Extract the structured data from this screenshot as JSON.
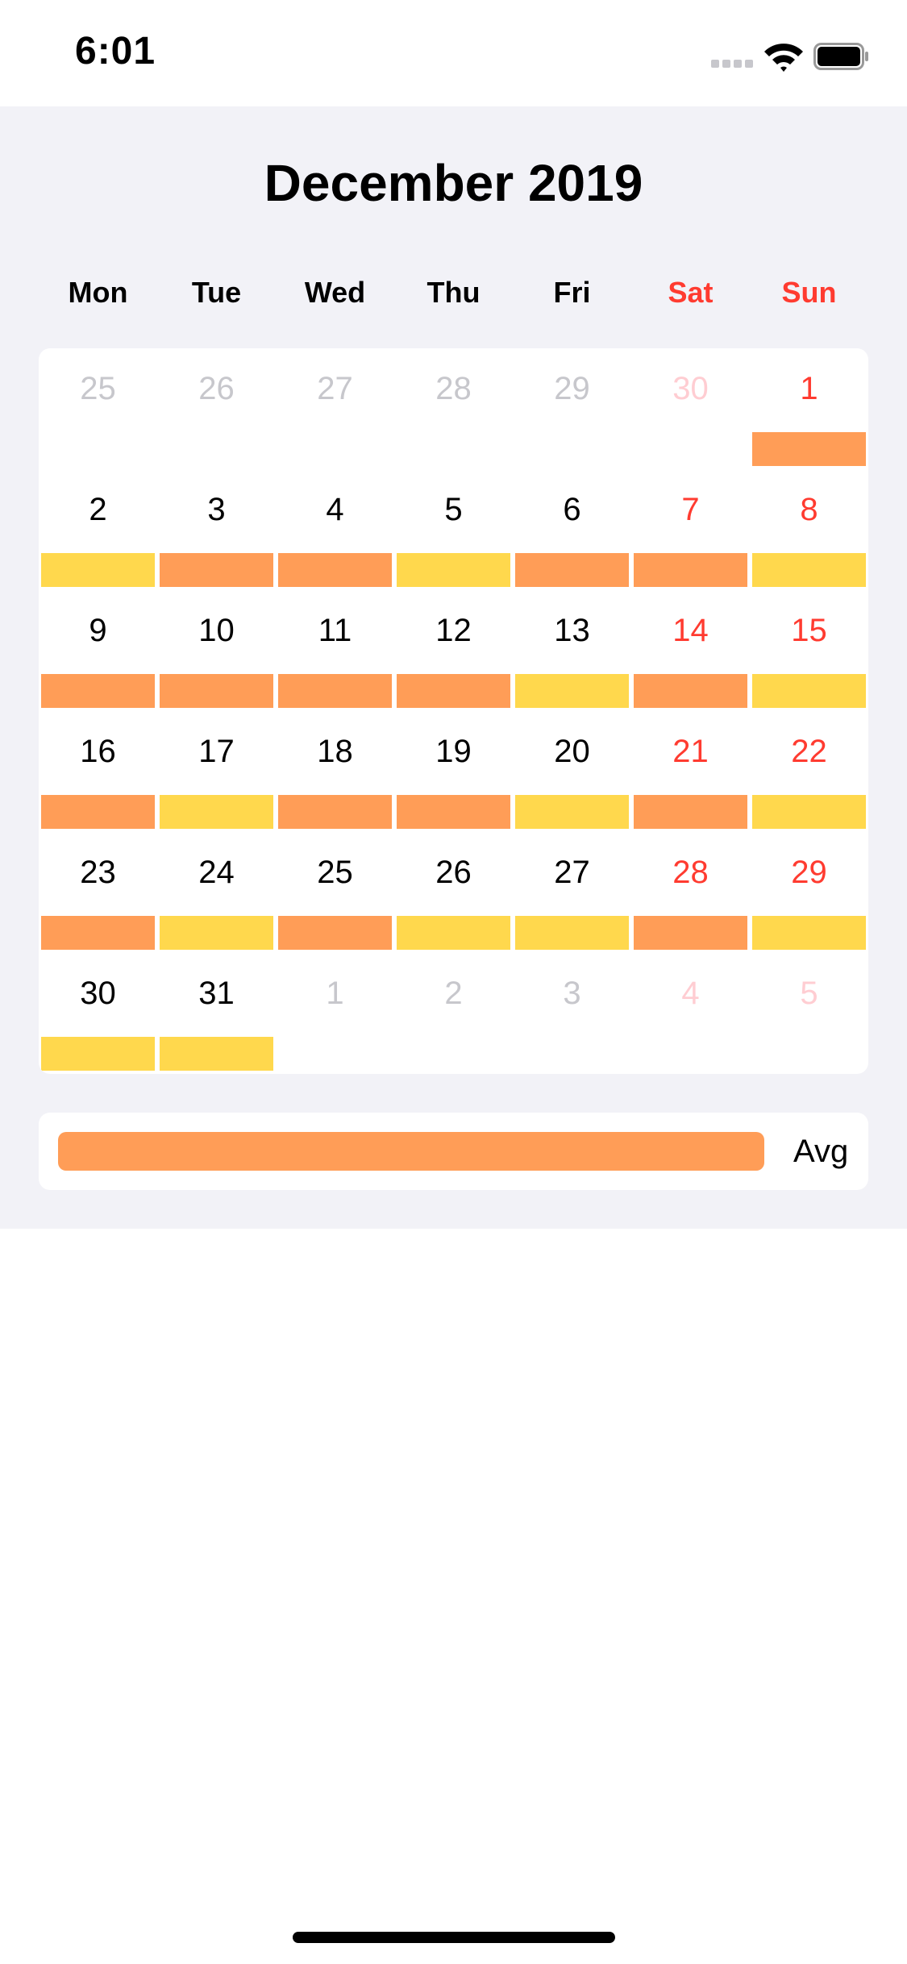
{
  "status_bar": {
    "time": "6:01"
  },
  "calendar": {
    "title": "December 2019",
    "weekdays": [
      {
        "label": "Mon",
        "weekend": false
      },
      {
        "label": "Tue",
        "weekend": false
      },
      {
        "label": "Wed",
        "weekend": false
      },
      {
        "label": "Thu",
        "weekend": false
      },
      {
        "label": "Fri",
        "weekend": false
      },
      {
        "label": "Sat",
        "weekend": true
      },
      {
        "label": "Sun",
        "weekend": true
      }
    ],
    "level_colors": {
      "high": "#ff9d57",
      "medium": "#ffd84d"
    },
    "weeks": [
      [
        {
          "day": "25",
          "current": false,
          "level": null
        },
        {
          "day": "26",
          "current": false,
          "level": null
        },
        {
          "day": "27",
          "current": false,
          "level": null
        },
        {
          "day": "28",
          "current": false,
          "level": null
        },
        {
          "day": "29",
          "current": false,
          "level": null
        },
        {
          "day": "30",
          "current": false,
          "level": null
        },
        {
          "day": "1",
          "current": true,
          "level": "high"
        }
      ],
      [
        {
          "day": "2",
          "current": true,
          "level": "medium"
        },
        {
          "day": "3",
          "current": true,
          "level": "high"
        },
        {
          "day": "4",
          "current": true,
          "level": "high"
        },
        {
          "day": "5",
          "current": true,
          "level": "medium"
        },
        {
          "day": "6",
          "current": true,
          "level": "high"
        },
        {
          "day": "7",
          "current": true,
          "level": "high"
        },
        {
          "day": "8",
          "current": true,
          "level": "medium"
        }
      ],
      [
        {
          "day": "9",
          "current": true,
          "level": "high"
        },
        {
          "day": "10",
          "current": true,
          "level": "high"
        },
        {
          "day": "11",
          "current": true,
          "level": "high"
        },
        {
          "day": "12",
          "current": true,
          "level": "high"
        },
        {
          "day": "13",
          "current": true,
          "level": "medium"
        },
        {
          "day": "14",
          "current": true,
          "level": "high"
        },
        {
          "day": "15",
          "current": true,
          "level": "medium"
        }
      ],
      [
        {
          "day": "16",
          "current": true,
          "level": "high"
        },
        {
          "day": "17",
          "current": true,
          "level": "medium"
        },
        {
          "day": "18",
          "current": true,
          "level": "high"
        },
        {
          "day": "19",
          "current": true,
          "level": "high"
        },
        {
          "day": "20",
          "current": true,
          "level": "medium"
        },
        {
          "day": "21",
          "current": true,
          "level": "high"
        },
        {
          "day": "22",
          "current": true,
          "level": "medium"
        }
      ],
      [
        {
          "day": "23",
          "current": true,
          "level": "high"
        },
        {
          "day": "24",
          "current": true,
          "level": "medium"
        },
        {
          "day": "25",
          "current": true,
          "level": "high"
        },
        {
          "day": "26",
          "current": true,
          "level": "medium"
        },
        {
          "day": "27",
          "current": true,
          "level": "medium"
        },
        {
          "day": "28",
          "current": true,
          "level": "high"
        },
        {
          "day": "29",
          "current": true,
          "level": "medium"
        }
      ],
      [
        {
          "day": "30",
          "current": true,
          "level": "medium"
        },
        {
          "day": "31",
          "current": true,
          "level": "medium"
        },
        {
          "day": "1",
          "current": false,
          "level": null
        },
        {
          "day": "2",
          "current": false,
          "level": null
        },
        {
          "day": "3",
          "current": false,
          "level": null
        },
        {
          "day": "4",
          "current": false,
          "level": null
        },
        {
          "day": "5",
          "current": false,
          "level": null
        }
      ]
    ]
  },
  "legend": {
    "label": "Avg",
    "color": "#ff9d57"
  }
}
